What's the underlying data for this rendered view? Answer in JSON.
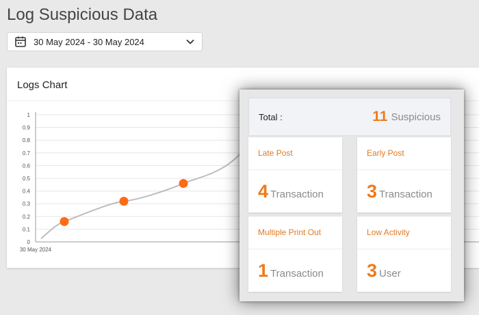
{
  "page": {
    "title": "Log Suspicious Data"
  },
  "date_range": {
    "value": "30 May 2024 - 30 May 2024",
    "icon": "calendar-icon",
    "dropdown_icon": "chevron-down-icon"
  },
  "logs_chart": {
    "title": "Logs Chart",
    "chart_data": {
      "type": "line",
      "x_tick_labels": [
        "30 May 2024"
      ],
      "y_ticks": [
        0,
        0.1,
        0.2,
        0.3,
        0.4,
        0.5,
        0.6,
        0.7,
        0.8,
        0.9,
        1
      ],
      "ylim": [
        0,
        1
      ],
      "points": [
        0.16,
        0.32,
        0.46
      ],
      "grid": true,
      "line_color": "#bdbdbd",
      "point_color": "#ff6a13"
    }
  },
  "summary": {
    "total_label": "Total :",
    "total_count": "11",
    "total_unit": "Suspicious",
    "accent_color": "#f07a18",
    "stats": [
      {
        "label": "Late Post",
        "count": "4",
        "unit": "Transaction"
      },
      {
        "label": "Early Post",
        "count": "3",
        "unit": "Transaction"
      },
      {
        "label": "Multiple Print Out",
        "count": "1",
        "unit": "Transaction"
      },
      {
        "label": "Low Activity",
        "count": "3",
        "unit": "User"
      }
    ]
  }
}
